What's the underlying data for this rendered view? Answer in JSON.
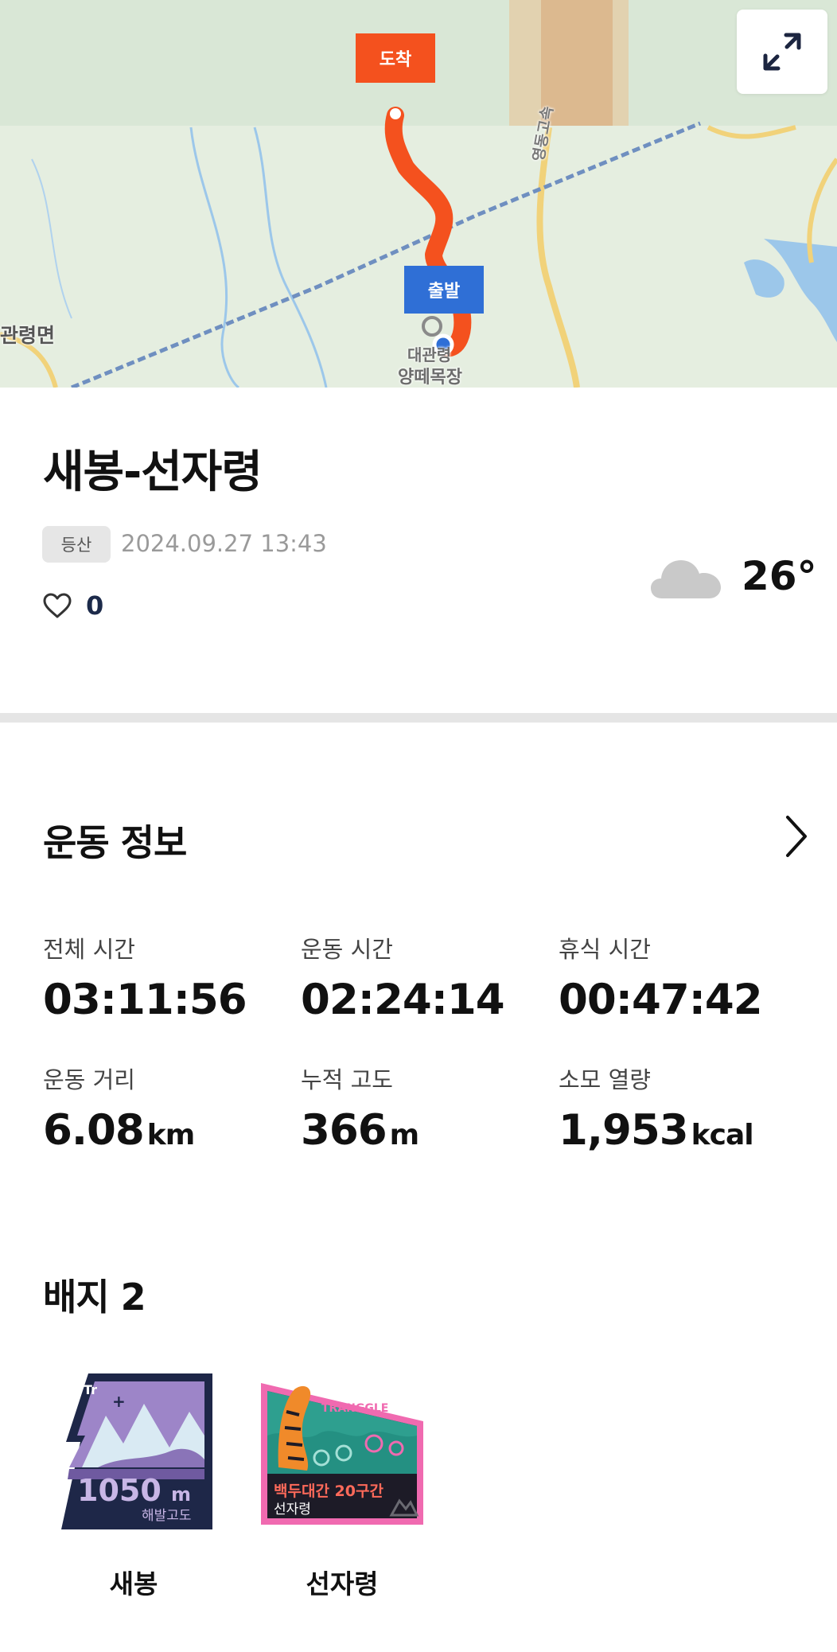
{
  "map": {
    "expand_icon": "expand-arrows-icon",
    "end_flag": "도착",
    "start_flag": "출발",
    "labels": {
      "area_left": "관령면",
      "place_1": "대관령",
      "place_2": "양떼목장",
      "road": "영동고속"
    },
    "route_color": "#f4511e",
    "start_color": "#2f6fd6"
  },
  "activity": {
    "title": "새봉-선자령",
    "tag": "등산",
    "datetime": "2024.09.27 13:43",
    "like_icon": "heart-outline-icon",
    "likes": "0",
    "weather_icon": "cloud-icon",
    "temperature": "26°"
  },
  "exercise": {
    "section_title": "운동 정보",
    "stats": [
      {
        "label": "전체 시간",
        "value": "03:11:56",
        "unit": ""
      },
      {
        "label": "운동 시간",
        "value": "02:24:14",
        "unit": ""
      },
      {
        "label": "휴식 시간",
        "value": "00:47:42",
        "unit": ""
      },
      {
        "label": "운동 거리",
        "value": "6.08",
        "unit": "km"
      },
      {
        "label": "누적 고도",
        "value": "366",
        "unit": "m"
      },
      {
        "label": "소모 열량",
        "value": "1,953",
        "unit": "kcal"
      }
    ]
  },
  "badges": {
    "section_title": "배지 2",
    "items": [
      {
        "name": "새봉",
        "art_text_main": "1050",
        "art_text_unit": "m",
        "art_text_sub": "해발고도"
      },
      {
        "name": "선자령",
        "art_text_brand": "TRANGGLE",
        "art_text_main": "백두대간 20구간",
        "art_text_sub": "선자령"
      }
    ]
  }
}
